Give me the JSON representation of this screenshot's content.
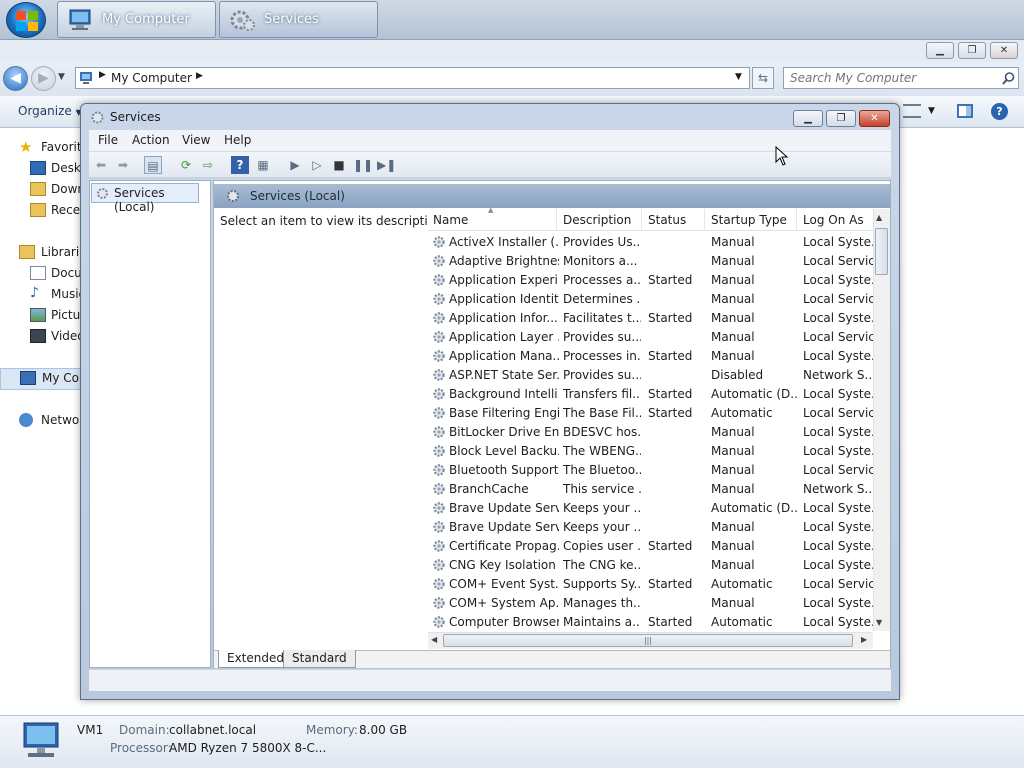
{
  "taskbar": {
    "buttons": [
      {
        "label": "My Computer"
      },
      {
        "label": "Services"
      }
    ]
  },
  "explorer": {
    "address": "My Computer",
    "search_placeholder": "Search My Computer",
    "organize_label": "Organize",
    "nav": [
      {
        "label": "Favorites",
        "icon": "star-icon"
      },
      {
        "label": "Desktop",
        "icon": "desktop-icon"
      },
      {
        "label": "Downloads",
        "icon": "folder-icon"
      },
      {
        "label": "Recent Places",
        "icon": "folder-icon"
      },
      {
        "label": "Libraries",
        "icon": "library-icon"
      },
      {
        "label": "Documents",
        "icon": "documents-icon"
      },
      {
        "label": "Music",
        "icon": "music-icon"
      },
      {
        "label": "Pictures",
        "icon": "pictures-icon"
      },
      {
        "label": "Videos",
        "icon": "videos-icon"
      },
      {
        "label": "My Computer",
        "icon": "computer-icon"
      },
      {
        "label": "Network",
        "icon": "network-icon"
      }
    ],
    "details": {
      "name": "VM1",
      "domain_label": "Domain:",
      "domain": "collabnet.local",
      "memory_label": "Memory:",
      "memory": "8.00 GB",
      "processor_label": "Processor:",
      "processor": "AMD Ryzen 7 5800X 8-C..."
    }
  },
  "services": {
    "title": "Services",
    "menu": [
      "File",
      "Action",
      "View",
      "Help"
    ],
    "tree_item": "Services (Local)",
    "pane_title": "Services (Local)",
    "description_prompt": "Select an item to view its description.",
    "columns": [
      "Name",
      "Description",
      "Status",
      "Startup Type",
      "Log On As"
    ],
    "rows": [
      {
        "name": "ActiveX Installer (...",
        "desc": "Provides Us...",
        "status": "",
        "startup": "Manual",
        "logon": "Local Syste..."
      },
      {
        "name": "Adaptive Brightness",
        "desc": "Monitors a...",
        "status": "",
        "startup": "Manual",
        "logon": "Local Service"
      },
      {
        "name": "Application Experi...",
        "desc": "Processes a...",
        "status": "Started",
        "startup": "Manual",
        "logon": "Local Syste..."
      },
      {
        "name": "Application Identity",
        "desc": "Determines ...",
        "status": "",
        "startup": "Manual",
        "logon": "Local Service"
      },
      {
        "name": "Application Infor...",
        "desc": "Facilitates t...",
        "status": "Started",
        "startup": "Manual",
        "logon": "Local Syste..."
      },
      {
        "name": "Application Layer ...",
        "desc": "Provides su...",
        "status": "",
        "startup": "Manual",
        "logon": "Local Service"
      },
      {
        "name": "Application Mana...",
        "desc": "Processes in...",
        "status": "Started",
        "startup": "Manual",
        "logon": "Local Syste..."
      },
      {
        "name": "ASP.NET State Ser...",
        "desc": "Provides su...",
        "status": "",
        "startup": "Disabled",
        "logon": "Network S..."
      },
      {
        "name": "Background Intelli...",
        "desc": "Transfers fil...",
        "status": "Started",
        "startup": "Automatic (D...",
        "logon": "Local Syste..."
      },
      {
        "name": "Base Filtering Engi...",
        "desc": "The Base Fil...",
        "status": "Started",
        "startup": "Automatic",
        "logon": "Local Service"
      },
      {
        "name": "BitLocker Drive En...",
        "desc": "BDESVC hos...",
        "status": "",
        "startup": "Manual",
        "logon": "Local Syste..."
      },
      {
        "name": "Block Level Backu...",
        "desc": "The WBENG...",
        "status": "",
        "startup": "Manual",
        "logon": "Local Syste..."
      },
      {
        "name": "Bluetooth Support...",
        "desc": "The Bluetoo...",
        "status": "",
        "startup": "Manual",
        "logon": "Local Service"
      },
      {
        "name": "BranchCache",
        "desc": "This service ...",
        "status": "",
        "startup": "Manual",
        "logon": "Network S..."
      },
      {
        "name": "Brave Update Serv...",
        "desc": "Keeps your ...",
        "status": "",
        "startup": "Automatic (D...",
        "logon": "Local Syste..."
      },
      {
        "name": "Brave Update Serv...",
        "desc": "Keeps your ...",
        "status": "",
        "startup": "Manual",
        "logon": "Local Syste..."
      },
      {
        "name": "Certificate Propag...",
        "desc": "Copies user ...",
        "status": "Started",
        "startup": "Manual",
        "logon": "Local Syste..."
      },
      {
        "name": "CNG Key Isolation",
        "desc": "The CNG ke...",
        "status": "",
        "startup": "Manual",
        "logon": "Local Syste..."
      },
      {
        "name": "COM+ Event Syst...",
        "desc": "Supports Sy...",
        "status": "Started",
        "startup": "Automatic",
        "logon": "Local Service"
      },
      {
        "name": "COM+ System Ap...",
        "desc": "Manages th...",
        "status": "",
        "startup": "Manual",
        "logon": "Local Syste..."
      },
      {
        "name": "Computer Browser",
        "desc": "Maintains a...",
        "status": "Started",
        "startup": "Automatic",
        "logon": "Local Syste..."
      }
    ],
    "tabs": [
      "Extended",
      "Standard"
    ]
  }
}
